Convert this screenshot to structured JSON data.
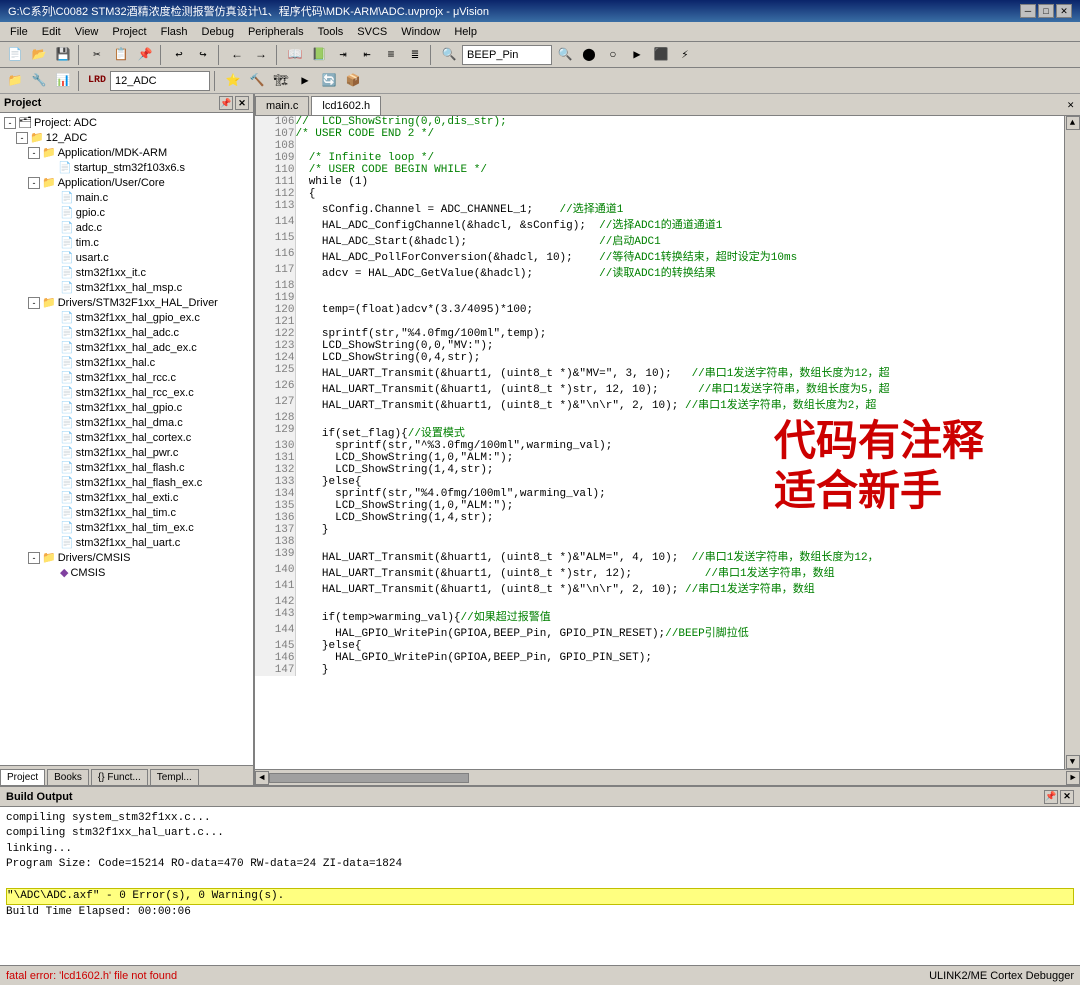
{
  "titlebar": {
    "title": "G:\\C系列\\C0082 STM32酒精浓度检测报警仿真设计\\1、程序代码\\MDK-ARM\\ADC.uvprojx - μVision",
    "minimize": "─",
    "maximize": "□",
    "close": "✕"
  },
  "menubar": {
    "items": [
      "File",
      "Edit",
      "View",
      "Project",
      "Flash",
      "Debug",
      "Peripherals",
      "Tools",
      "SVCS",
      "Window",
      "Help"
    ]
  },
  "toolbar": {
    "combo_value": "12_ADC",
    "beep_pin": "BEEP_Pin"
  },
  "project": {
    "title": "Project",
    "root": "Project: ADC",
    "tree": [
      {
        "label": "Project: ADC",
        "level": 0,
        "type": "root",
        "expanded": true
      },
      {
        "label": "12_ADC",
        "level": 1,
        "type": "folder",
        "expanded": true
      },
      {
        "label": "Application/MDK-ARM",
        "level": 2,
        "type": "folder",
        "expanded": true
      },
      {
        "label": "startup_stm32f103x6.s",
        "level": 3,
        "type": "file"
      },
      {
        "label": "Application/User/Core",
        "level": 2,
        "type": "folder",
        "expanded": true
      },
      {
        "label": "main.c",
        "level": 3,
        "type": "file"
      },
      {
        "label": "gpio.c",
        "level": 3,
        "type": "file"
      },
      {
        "label": "adc.c",
        "level": 3,
        "type": "file"
      },
      {
        "label": "tim.c",
        "level": 3,
        "type": "file"
      },
      {
        "label": "usart.c",
        "level": 3,
        "type": "file"
      },
      {
        "label": "stm32f1xx_it.c",
        "level": 3,
        "type": "file"
      },
      {
        "label": "stm32f1xx_hal_msp.c",
        "level": 3,
        "type": "file"
      },
      {
        "label": "Drivers/STM32F1xx_HAL_Driver",
        "level": 2,
        "type": "folder",
        "expanded": true
      },
      {
        "label": "stm32f1xx_hal_gpio_ex.c",
        "level": 3,
        "type": "file"
      },
      {
        "label": "stm32f1xx_hal_adc.c",
        "level": 3,
        "type": "file"
      },
      {
        "label": "stm32f1xx_hal_adc_ex.c",
        "level": 3,
        "type": "file"
      },
      {
        "label": "stm32f1xx_hal.c",
        "level": 3,
        "type": "file"
      },
      {
        "label": "stm32f1xx_hal_rcc.c",
        "level": 3,
        "type": "file"
      },
      {
        "label": "stm32f1xx_hal_rcc_ex.c",
        "level": 3,
        "type": "file"
      },
      {
        "label": "stm32f1xx_hal_gpio.c",
        "level": 3,
        "type": "file"
      },
      {
        "label": "stm32f1xx_hal_dma.c",
        "level": 3,
        "type": "file"
      },
      {
        "label": "stm32f1xx_hal_cortex.c",
        "level": 3,
        "type": "file"
      },
      {
        "label": "stm32f1xx_hal_pwr.c",
        "level": 3,
        "type": "file"
      },
      {
        "label": "stm32f1xx_hal_flash.c",
        "level": 3,
        "type": "file"
      },
      {
        "label": "stm32f1xx_hal_flash_ex.c",
        "level": 3,
        "type": "file"
      },
      {
        "label": "stm32f1xx_hal_exti.c",
        "level": 3,
        "type": "file"
      },
      {
        "label": "stm32f1xx_hal_tim.c",
        "level": 3,
        "type": "file"
      },
      {
        "label": "stm32f1xx_hal_tim_ex.c",
        "level": 3,
        "type": "file"
      },
      {
        "label": "stm32f1xx_hal_uart.c",
        "level": 3,
        "type": "file"
      },
      {
        "label": "Drivers/CMSIS",
        "level": 2,
        "type": "folder",
        "expanded": true
      },
      {
        "label": "CMSIS",
        "level": 3,
        "type": "diamond"
      }
    ],
    "tabs": [
      "Project",
      "Books",
      "{} Funct...",
      "Templ..."
    ]
  },
  "editor": {
    "tabs": [
      "main.c",
      "lcd1602.h"
    ],
    "active_tab": "lcd1602.h",
    "lines": [
      {
        "num": 106,
        "text": "//  LCD_ShowString(0,0,dis_str);"
      },
      {
        "num": 107,
        "text": "/* USER CODE END 2 */"
      },
      {
        "num": 108,
        "text": ""
      },
      {
        "num": 109,
        "text": "  /* Infinite loop */"
      },
      {
        "num": 110,
        "text": "  /* USER CODE BEGIN WHILE */"
      },
      {
        "num": 111,
        "text": "  while (1)"
      },
      {
        "num": 112,
        "text": "  {"
      },
      {
        "num": 113,
        "text": "    sConfig.Channel = ADC_CHANNEL_1;    //选择通道1"
      },
      {
        "num": 114,
        "text": "    HAL_ADC_ConfigChannel(&hadcl, &sConfig);  //选择ADC1的通道通道1"
      },
      {
        "num": 115,
        "text": "    HAL_ADC_Start(&hadcl);                    //启动ADC1"
      },
      {
        "num": 116,
        "text": "    HAL_ADC_PollForConversion(&hadcl, 10);    //等待ADC1转换结束，超时设定为10ms"
      },
      {
        "num": 117,
        "text": "    adcv = HAL_ADC_GetValue(&hadcl);          //读取ADC1的转换结果"
      },
      {
        "num": 118,
        "text": ""
      },
      {
        "num": 119,
        "text": ""
      },
      {
        "num": 120,
        "text": "    temp=(float)adcv*(3.3/4095)*100;"
      },
      {
        "num": 121,
        "text": ""
      },
      {
        "num": 122,
        "text": "    sprintf(str,\"%4.0fmg/100ml\",temp);"
      },
      {
        "num": 123,
        "text": "    LCD_ShowString(0,0,\"MV:\");"
      },
      {
        "num": 124,
        "text": "    LCD_ShowString(0,4,str);"
      },
      {
        "num": 125,
        "text": "    HAL_UART_Transmit(&huart1, (uint8_t *)&\"MV=\", 3, 10);   //串口1发送字符串，数组长度为12，超"
      },
      {
        "num": 126,
        "text": "    HAL_UART_Transmit(&huart1, (uint8_t *)str, 12, 10);      //串口1发送字符串，数组长度为5，超"
      },
      {
        "num": 127,
        "text": "    HAL_UART_Transmit(&huart1, (uint8_t *)&\"\\n\\r\", 2, 10); //串口1发送字符串，数组长度为2，超"
      },
      {
        "num": 128,
        "text": ""
      },
      {
        "num": 129,
        "text": "    if(set_flag){//设置模式"
      },
      {
        "num": 130,
        "text": "      sprintf(str,\"^%3.0fmg/100ml\",warming_val);"
      },
      {
        "num": 131,
        "text": "      LCD_ShowString(1,0,\"ALM:\");"
      },
      {
        "num": 132,
        "text": "      LCD_ShowString(1,4,str);"
      },
      {
        "num": 133,
        "text": "    }else{"
      },
      {
        "num": 134,
        "text": "      sprintf(str,\"%4.0fmg/100ml\",warming_val);"
      },
      {
        "num": 135,
        "text": "      LCD_ShowString(1,0,\"ALM:\");"
      },
      {
        "num": 136,
        "text": "      LCD_ShowString(1,4,str);"
      },
      {
        "num": 137,
        "text": "    }"
      },
      {
        "num": 138,
        "text": ""
      },
      {
        "num": 139,
        "text": "    HAL_UART_Transmit(&huart1, (uint8_t *)&\"ALM=\", 4, 10);  //串口1发送字符串，数组长度为12，"
      },
      {
        "num": 140,
        "text": "    HAL_UART_Transmit(&huart1, (uint8_t *)str, 12);           //串口1发送字符串，数组"
      },
      {
        "num": 141,
        "text": "    HAL_UART_Transmit(&huart1, (uint8_t *)&\"\\n\\r\", 2, 10); //串口1发送字符串，数组"
      },
      {
        "num": 142,
        "text": ""
      },
      {
        "num": 143,
        "text": "    if(temp>warming_val){//如果超过报警值"
      },
      {
        "num": 144,
        "text": "      HAL_GPIO_WritePin(GPIOA,BEEP_Pin, GPIO_PIN_RESET);//BEEP引脚拉低"
      },
      {
        "num": 145,
        "text": "    }else{"
      },
      {
        "num": 146,
        "text": "      HAL_GPIO_WritePin(GPIOA,BEEP_Pin, GPIO_PIN_SET);"
      },
      {
        "num": 147,
        "text": "    }"
      }
    ],
    "annotation_line1": "代码有注释",
    "annotation_line2": "适合新手"
  },
  "build_output": {
    "title": "Build Output",
    "lines": [
      "compiling system_stm32f1xx.c...",
      "compiling stm32f1xx_hal_uart.c...",
      "linking...",
      "Program Size: Code=15214 RO-data=470 RW-data=24 ZI-data=1824",
      "",
      "\"\\ADC\\ADC.axf\" - 0 Error(s), 0 Warning(s).",
      "Build Time Elapsed: 00:00:06"
    ],
    "highlighted_line": "\"\\ADC\\ADC.axf\" - 0 Error(s), 0 Warning(s)."
  },
  "statusbar": {
    "error_text": "fatal error: 'lcd1602.h' file not found",
    "right_text": "ULINK2/ME Cortex Debugger"
  }
}
